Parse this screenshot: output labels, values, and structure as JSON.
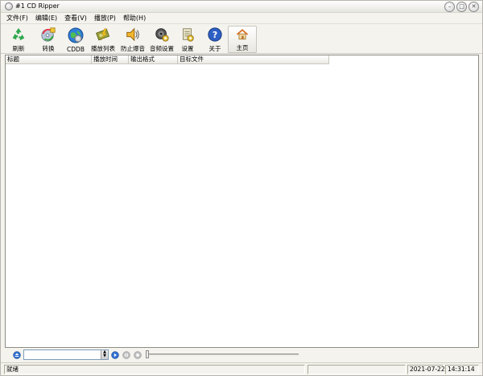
{
  "window": {
    "title": "#1 CD Ripper"
  },
  "menu": [
    "文件(F)",
    "编辑(E)",
    "查看(V)",
    "播放(P)",
    "帮助(H)"
  ],
  "toolbar": [
    {
      "label": "刷新",
      "icon": "recycle-icon"
    },
    {
      "label": "转换",
      "icon": "convert-icon"
    },
    {
      "label": "CDDB",
      "icon": "globe-icon"
    },
    {
      "label": "播放列表",
      "icon": "playlist-icon"
    },
    {
      "label": "防止爆音",
      "icon": "speaker-icon"
    },
    {
      "label": "音频设置",
      "icon": "audio-settings-icon"
    },
    {
      "label": "设置",
      "icon": "settings-icon"
    },
    {
      "label": "关于",
      "icon": "help-icon"
    },
    {
      "label": "主页",
      "icon": "home-icon"
    }
  ],
  "list": {
    "columns": [
      "标题",
      "播放时间",
      "输出格式",
      "目标文件"
    ]
  },
  "status": {
    "text": "就绪",
    "date": "2021-07-22",
    "time": "14:31:14"
  }
}
